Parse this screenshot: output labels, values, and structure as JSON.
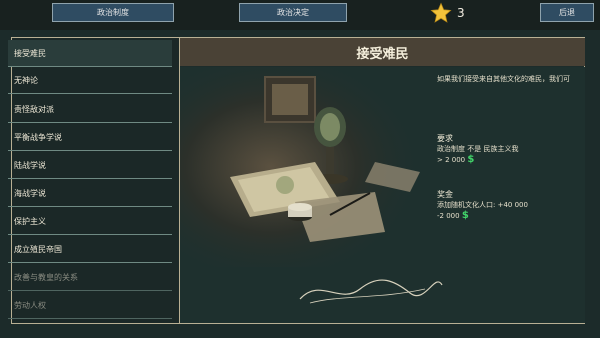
{
  "top": {
    "left_button": "政治制度",
    "center_button": "政治决定",
    "star_count": "3",
    "back_button": "后退"
  },
  "sidebar": {
    "items": [
      {
        "label": "接受难民",
        "state": "active"
      },
      {
        "label": "无神论",
        "state": "normal"
      },
      {
        "label": "责怪敌对派",
        "state": "normal"
      },
      {
        "label": "平衡战争学说",
        "state": "normal"
      },
      {
        "label": "陆战学说",
        "state": "normal"
      },
      {
        "label": "海战学说",
        "state": "normal"
      },
      {
        "label": "保护主义",
        "state": "normal"
      },
      {
        "label": "成立殖民帝国",
        "state": "normal"
      },
      {
        "label": "改善与教皇的关系",
        "state": "disabled"
      },
      {
        "label": "劳动人权",
        "state": "disabled"
      }
    ]
  },
  "detail": {
    "title": "接受难民",
    "description": "如果我们接受来自其他文化的难民，我们可",
    "requirements_heading": "要求",
    "requirement_1": "政治制度 不是 民族主义我",
    "requirement_2_value": "> 2 000",
    "rewards_heading": "奖金",
    "reward_1": "添加随机文化人口: +40 000",
    "reward_2_value": "-2 000"
  },
  "colors": {
    "money_icon": "#42d46a",
    "button_bg": "#2f4c62",
    "title_bar": "#4a4236",
    "frame_border": "#b9b094",
    "star": "#f2c23a"
  },
  "icons": {
    "star": "star-icon",
    "money": "dollar-icon"
  }
}
